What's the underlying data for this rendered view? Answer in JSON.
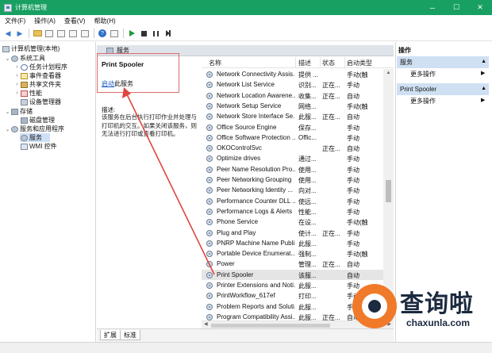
{
  "window": {
    "title": "计算机管理",
    "minimize": "─",
    "maximize": "☐",
    "close": "✕"
  },
  "menu": [
    "文件(F)",
    "操作(A)",
    "查看(V)",
    "帮助(H)"
  ],
  "tree": {
    "root": "计算机管理(本地)",
    "system_tools": "系统工具",
    "task_scheduler": "任务计划程序",
    "event_viewer": "事件查看器",
    "shared_folders": "共享文件夹",
    "performance": "性能",
    "device_manager": "设备管理器",
    "storage": "存储",
    "disk_management": "磁盘管理",
    "services_apps": "服务和应用程序",
    "services": "服务",
    "wmi": "WMI 控件"
  },
  "center_header": "服务",
  "info": {
    "service_title": "Print Spooler",
    "start_link": "启动",
    "start_suffix": "此服务",
    "desc_label": "描述:",
    "desc_text": "该服务在后台执行打印作业并处理与打印机的交互。如果关闭该服务，则无法进行打印或查看打印机。"
  },
  "list": {
    "headers": {
      "name": "名称",
      "desc": "描述",
      "status": "状态",
      "startup": "启动类型"
    },
    "rows": [
      {
        "name": "Network Connectivity Assis...",
        "desc": "提供 ...",
        "status": "",
        "startup": "手动(触"
      },
      {
        "name": "Network List Service",
        "desc": "识别...",
        "status": "正在...",
        "startup": "手动"
      },
      {
        "name": "Network Location Awarene...",
        "desc": "收集...",
        "status": "正在...",
        "startup": "自动"
      },
      {
        "name": "Network Setup Service",
        "desc": "网络...",
        "status": "",
        "startup": "手动(触"
      },
      {
        "name": "Network Store Interface Se...",
        "desc": "此服...",
        "status": "正在...",
        "startup": "自动"
      },
      {
        "name": "Office  Source Engine",
        "desc": "保存...",
        "status": "",
        "startup": "手动"
      },
      {
        "name": "Office Software Protection ...",
        "desc": "Offic...",
        "status": "",
        "startup": "手动"
      },
      {
        "name": "OKOControlSvc",
        "desc": "",
        "status": "正在...",
        "startup": "自动"
      },
      {
        "name": "Optimize drives",
        "desc": "通过...",
        "status": "",
        "startup": "手动"
      },
      {
        "name": "Peer Name Resolution Pro...",
        "desc": "使用...",
        "status": "",
        "startup": "手动"
      },
      {
        "name": "Peer Networking Grouping",
        "desc": "使用...",
        "status": "",
        "startup": "手动"
      },
      {
        "name": "Peer Networking Identity ...",
        "desc": "向对...",
        "status": "",
        "startup": "手动"
      },
      {
        "name": "Performance Counter DLL ...",
        "desc": "使远...",
        "status": "",
        "startup": "手动"
      },
      {
        "name": "Performance Logs & Alerts",
        "desc": "性能...",
        "status": "",
        "startup": "手动"
      },
      {
        "name": "Phone Service",
        "desc": "在设...",
        "status": "",
        "startup": "手动(触"
      },
      {
        "name": "Plug and Play",
        "desc": "使计...",
        "status": "正在...",
        "startup": "手动"
      },
      {
        "name": "PNRP Machine Name Publi...",
        "desc": "此服...",
        "status": "",
        "startup": "手动"
      },
      {
        "name": "Portable Device Enumerat...",
        "desc": "强制...",
        "status": "",
        "startup": "手动(触"
      },
      {
        "name": "Power",
        "desc": "管理...",
        "status": "正在...",
        "startup": "自动"
      },
      {
        "name": "Print Spooler",
        "desc": "该服...",
        "status": "",
        "startup": "自动"
      },
      {
        "name": "Printer Extensions and Noti...",
        "desc": "此服...",
        "status": "",
        "startup": "手动"
      },
      {
        "name": "PrintWorkflow_617ef",
        "desc": "打印...",
        "status": "",
        "startup": "手动"
      },
      {
        "name": "Problem Reports and Soluti...",
        "desc": "此服...",
        "status": "",
        "startup": "手动"
      },
      {
        "name": "Program Compatibility Assi...",
        "desc": "此服...",
        "status": "正在...",
        "startup": "自动"
      }
    ]
  },
  "tabs": [
    "扩展",
    "标准"
  ],
  "actions": {
    "title": "操作",
    "group1": "服务",
    "more1": "更多操作",
    "group2": "Print Spooler",
    "more2": "更多操作",
    "arrow": "▶",
    "up": "▲"
  },
  "watermark": {
    "cn": "查询啦",
    "en": "chaxunla.com"
  },
  "colors": {
    "titlebar": "#18a062",
    "annotation": "#e0453f",
    "watermark_orange": "#f07a2a"
  }
}
